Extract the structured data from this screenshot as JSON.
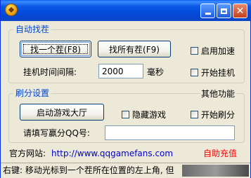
{
  "window": {
    "title": "",
    "icon": "app-coin-icon",
    "controls": {
      "minimize_icon": "minimize-icon",
      "maximize_icon": "maximize-icon",
      "close_icon": "close-icon"
    }
  },
  "auto_find": {
    "legend": "自动找茬",
    "find_one_button": "找一个茬(F8)",
    "find_all_button": "找所有茬(F9)",
    "enable_speedup_label": "启用加速",
    "interval_label": "挂机时间间隔:",
    "interval_value": "2000",
    "interval_unit": "毫秒",
    "start_autoplay_label": "开始挂机"
  },
  "score": {
    "legend": "刷分设置",
    "other_functions_label": "其他功能",
    "launch_lobby_button": "启动游戏大厅",
    "hide_game_label": "隐藏游戏",
    "start_scoring_label": "开始刷分",
    "qq_label": "请填写赢分QQ号:",
    "qq_value": ""
  },
  "footer": {
    "website_label": "官方网站:",
    "website_url": "http://www.qqgamefans.com",
    "recharge_link": "自助充值"
  },
  "statusbar": {
    "message": "右键: 移动光标到一个茬所在位置的左上角, 但"
  },
  "colors": {
    "titlebar": "#0a58e6",
    "legend": "#0046d5",
    "link": "#0000cc",
    "recharge": "#ff0000"
  }
}
